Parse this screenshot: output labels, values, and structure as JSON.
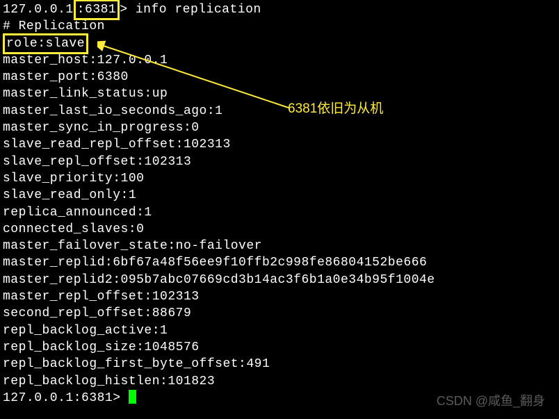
{
  "terminal": {
    "prompt_ip": "127.0.0.1",
    "prompt_port_hl": ":6381",
    "prompt_suffix": "> ",
    "command": "info replication",
    "section_header": "# Replication",
    "role_key": "role:",
    "role_value": "slave",
    "lines": {
      "master_host": "master_host:127.0.0.1",
      "master_port": "master_port:6380",
      "master_link_status": "master_link_status:up",
      "master_last_io": "master_last_io_seconds_ago:1",
      "master_sync": "master_sync_in_progress:0",
      "slave_read_repl": "slave_read_repl_offset:102313",
      "slave_repl_offset": "slave_repl_offset:102313",
      "slave_priority": "slave_priority:100",
      "slave_read_only": "slave_read_only:1",
      "replica_announced": "replica_announced:1",
      "connected_slaves": "connected_slaves:0",
      "master_failover": "master_failover_state:no-failover",
      "master_replid": "master_replid:6bf67a48f56ee9f10ffb2c998fe86804152be666",
      "master_replid2": "master_replid2:095b7abc07669cd3b14ac3f6b1a0e34b95f1004e",
      "master_repl_offset": "master_repl_offset:102313",
      "second_repl_offset": "second_repl_offset:88679",
      "repl_backlog_active": "repl_backlog_active:1",
      "repl_backlog_size": "repl_backlog_size:1048576",
      "repl_backlog_first": "repl_backlog_first_byte_offset:491",
      "repl_backlog_histlen": "repl_backlog_histlen:101823"
    },
    "bottom_prompt": "127.0.0.1:6381> "
  },
  "annotation": {
    "text": "6381依旧为从机"
  },
  "watermark": {
    "text": "CSDN @咸鱼_翻身"
  }
}
